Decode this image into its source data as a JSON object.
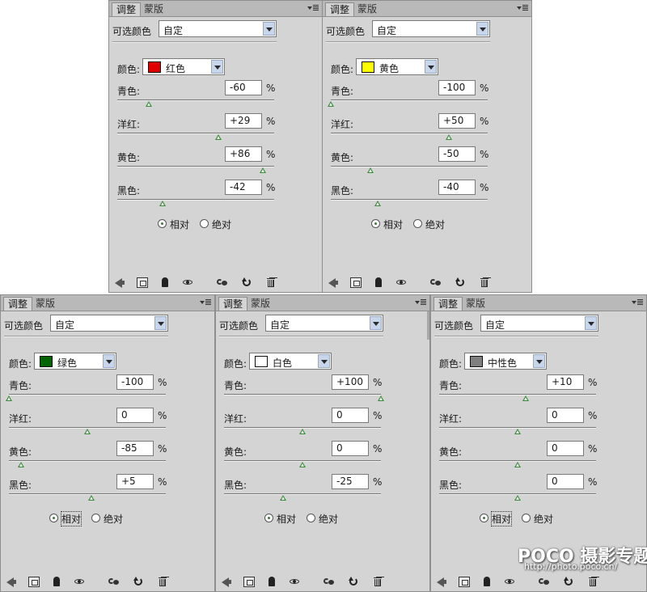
{
  "tabs": {
    "adjust": "调整",
    "mask": "蒙版"
  },
  "preset_label": "可选颜色",
  "preset_value": "自定",
  "color_label": "颜色:",
  "row_labels": {
    "cyan": "青色:",
    "magenta": "洋红:",
    "yellow": "黄色:",
    "black": "黑色:"
  },
  "percent": "%",
  "method": {
    "relative": "相对",
    "absolute": "绝对"
  },
  "panels": [
    {
      "color_name": "红色",
      "swatch": "#e00000",
      "values": {
        "cyan": "-60",
        "magenta": "+29",
        "yellow": "+86",
        "black": "-42"
      },
      "method": "relative",
      "relative_focused": false
    },
    {
      "color_name": "黄色",
      "swatch": "#ffff00",
      "values": {
        "cyan": "-100",
        "magenta": "+50",
        "yellow": "-50",
        "black": "-40"
      },
      "method": "relative",
      "relative_focused": false
    },
    {
      "color_name": "绿色",
      "swatch": "#006400",
      "values": {
        "cyan": "-100",
        "magenta": "0",
        "yellow": "-85",
        "black": "+5"
      },
      "method": "relative",
      "relative_focused": true
    },
    {
      "color_name": "白色",
      "swatch": "#ffffff",
      "values": {
        "cyan": "+100",
        "magenta": "0",
        "yellow": "0",
        "black": "-25"
      },
      "method": "relative",
      "relative_focused": false
    },
    {
      "color_name": "中性色",
      "swatch": "#808080",
      "values": {
        "cyan": "+10",
        "magenta": "0",
        "yellow": "0",
        "black": "0"
      },
      "method": "relative",
      "relative_focused": true
    }
  ],
  "footer_icons": [
    "back-arrow-icon",
    "clip-layer-icon",
    "mask-icon",
    "eye-icon",
    "view-previous-icon",
    "reset-icon",
    "trash-icon"
  ],
  "watermark": {
    "brand": "POCO 摄影专题",
    "url": "http://photo.poco.cn/"
  }
}
